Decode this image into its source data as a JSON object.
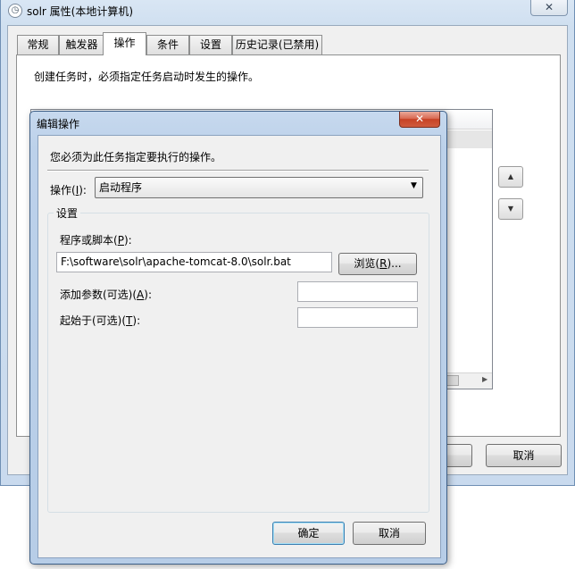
{
  "main_window": {
    "title": "solr 属性(本地计算机)",
    "close_glyph": "✕",
    "tabs": [
      {
        "label": "常规"
      },
      {
        "label": "触发器"
      },
      {
        "label": "操作",
        "active": true
      },
      {
        "label": "条件"
      },
      {
        "label": "设置"
      },
      {
        "label": "历史记录(已禁用)"
      }
    ],
    "panel_description": "创建任务时，必须指定任务启动时发生的操作。",
    "move_up_glyph": "▲",
    "move_down_glyph": "▼",
    "scroll_right_glyph": "▶",
    "cancel_label": "取消"
  },
  "dialog": {
    "title": "编辑操作",
    "close_glyph": "✕",
    "description": "您必须为此任务指定要执行的操作。",
    "action": {
      "label_prefix": "操作(",
      "label_key": "I",
      "label_suffix": "):",
      "selected": "启动程序",
      "arrow_glyph": "▼"
    },
    "settings_group": "设置",
    "program": {
      "label_prefix": "程序或脚本(",
      "label_key": "P",
      "label_suffix": "):",
      "value": "F:\\software\\solr\\apache-tomcat-8.0\\solr.bat",
      "browse_prefix": "浏览(",
      "browse_key": "R",
      "browse_suffix": ")..."
    },
    "arguments": {
      "label_prefix": "添加参数(可选)(",
      "label_key": "A",
      "label_suffix": "):",
      "value": ""
    },
    "start_in": {
      "label_prefix": "起始于(可选)(",
      "label_key": "T",
      "label_suffix": "):",
      "value": ""
    },
    "ok_label": "确定",
    "cancel_label": "取消"
  }
}
